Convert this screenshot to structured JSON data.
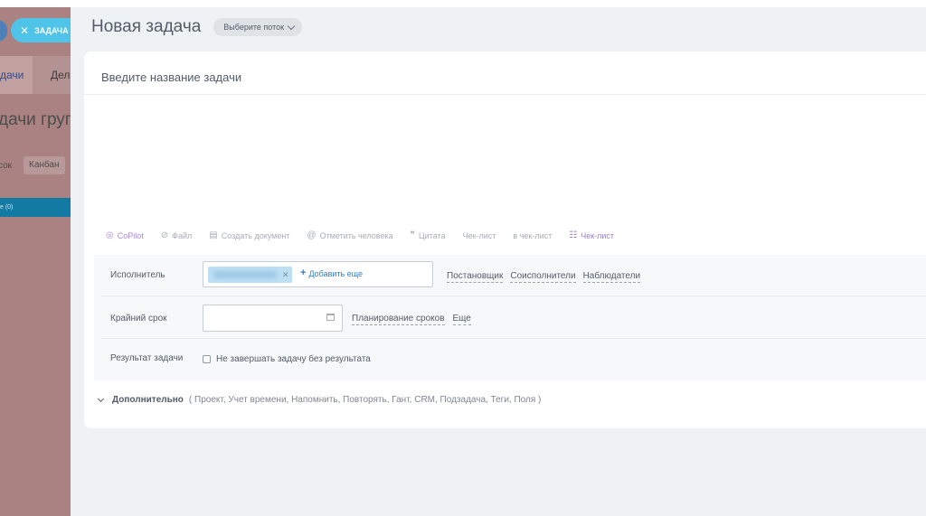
{
  "background": {
    "task_button": "ЗАДАЧА",
    "tab_tasks": "дачи",
    "tab_other": "Дела",
    "heading": "дачи групп",
    "view_list": "сок",
    "view_kanban": "Канбан",
    "bar_text": "е (0)"
  },
  "header": {
    "title": "Новая задача",
    "flow_select": "Выберите поток"
  },
  "task_title": {
    "placeholder": "Введите название задачи"
  },
  "toolbar": {
    "copilot": "CoPilot",
    "file": "Файл",
    "create_doc": "Создать документ",
    "mention": "Отметить человека",
    "quote": "Цитата",
    "checklist": "Чек-лист",
    "in_checklist": "в чек-лист",
    "checklist2": "Чек-лист"
  },
  "fields": {
    "assignee": {
      "label": "Исполнитель",
      "add_more": "Добавить еще",
      "links": [
        "Постановщик",
        "Соисполнители",
        "Наблюдатели"
      ]
    },
    "deadline": {
      "label": "Крайний срок",
      "links": [
        "Планирование сроков",
        "Еще"
      ]
    },
    "result": {
      "label": "Результат задачи",
      "checkbox_label": "Не завершать задачу без результата"
    }
  },
  "extra": {
    "title": "Дополнительно",
    "items": "( Проект, Учет времени, Напомнить, Повторять, Гант, CRM, Подзадача, Теги, Поля )"
  }
}
